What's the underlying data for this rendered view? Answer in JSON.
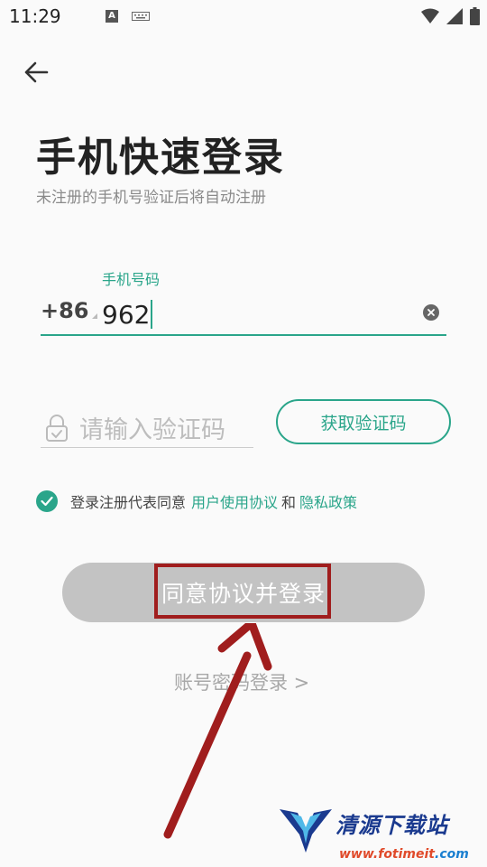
{
  "status_bar": {
    "time": "11:29",
    "icons": [
      "a-icon",
      "keyboard-icon",
      "wifi-icon",
      "signal-icon",
      "battery-icon"
    ]
  },
  "header": {
    "back_icon": "arrow-left-icon"
  },
  "page": {
    "title": "手机快速登录",
    "subtitle": "未注册的手机号验证后将自动注册"
  },
  "phone": {
    "label": "手机号码",
    "country_code": "+86",
    "value": "962",
    "clear_icon": "clear-icon"
  },
  "code": {
    "placeholder": "请输入验证码",
    "get_code_label": "获取验证码",
    "lock_icon": "lock-icon"
  },
  "agreement": {
    "checked": true,
    "prefix": "登录注册代表同意",
    "user_agreement": "用户使用协议",
    "and": "和",
    "privacy_policy": "隐私政策"
  },
  "login_button": {
    "label": "同意协议并登录"
  },
  "password_login": {
    "label": "账号密码登录 >"
  },
  "watermark": {
    "name": "清源下载站",
    "url_prefix": "www.fotimeit",
    "url_suffix": ".com"
  },
  "colors": {
    "accent": "#2aa58a",
    "button_disabled": "#c3c3c3",
    "annotation": "#a01d1d"
  }
}
